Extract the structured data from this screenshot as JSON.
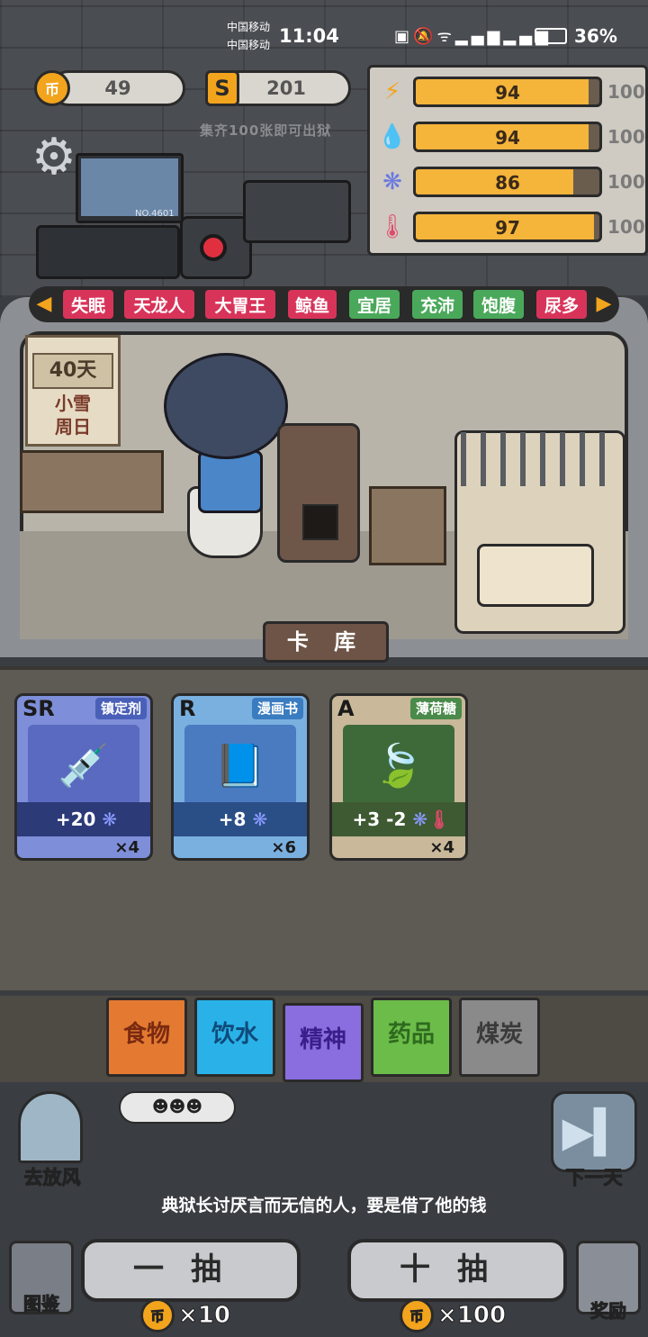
{
  "status_bar": {
    "carrier1": "中国移动",
    "carrier2": "中国移动",
    "time": "11:04",
    "battery": "36%"
  },
  "currency": {
    "coin_icon_label": "币",
    "coins": "49",
    "cards_icon_label": "S",
    "cards": "201",
    "hint": "集齐100张即可出狱"
  },
  "stats": [
    {
      "icon": "energy-icon",
      "value": "94",
      "max": "100",
      "fill": 0.94
    },
    {
      "icon": "water-drop-icon",
      "value": "94",
      "max": "100",
      "fill": 0.94
    },
    {
      "icon": "brain-icon",
      "value": "86",
      "max": "100",
      "fill": 0.86
    },
    {
      "icon": "thermometer-icon",
      "value": "97",
      "max": "100",
      "fill": 0.97
    }
  ],
  "monitor_label": "NO.4601",
  "tags": [
    "失眠",
    "天龙人",
    "大胃王",
    "鲸鱼",
    "宜居",
    "充沛",
    "饱腹",
    "尿多"
  ],
  "calendar": {
    "days": "40天",
    "weather": "小雪",
    "weekday": "周日"
  },
  "card_library_title": "卡 库",
  "cards": [
    {
      "rank": "SR",
      "name": "镇定剂",
      "effect": "+20",
      "count": "×4"
    },
    {
      "rank": "R",
      "name": "漫画书",
      "effect": "+8",
      "count": "×6"
    },
    {
      "rank": "A",
      "name": "薄荷糖",
      "effect": "+3  -2",
      "count": "×4"
    }
  ],
  "categories": [
    "食物",
    "饮水",
    "精神",
    "药品",
    "煤炭"
  ],
  "bottom": {
    "go_out": "去放风",
    "next_day": "下一天",
    "gossip": "典狱长讨厌言而无信的人，要是借了他的钱",
    "atlas": "图鉴",
    "reward": "奖励",
    "draw_one": "一抽",
    "draw_ten": "十抽",
    "draw_one_cost": "×10",
    "draw_ten_cost": "×100"
  },
  "colors": {
    "accent": "#f3a41d",
    "tag_pink": "#d8345a",
    "tag_green": "#4aa85a",
    "bar_fill": "#f5b43a"
  }
}
